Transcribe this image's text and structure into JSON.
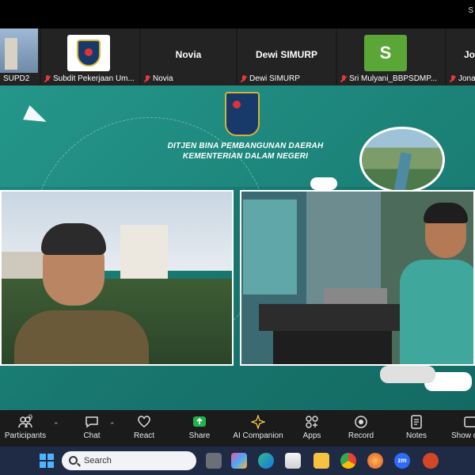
{
  "topbar": {
    "corner_text": "S"
  },
  "participants": [
    {
      "name": "SUPD2",
      "display": ""
    },
    {
      "name": "Subdit Pekerjaan Um...",
      "display": ""
    },
    {
      "name": "Novia",
      "display": "Novia"
    },
    {
      "name": "Dewi SIMURP",
      "display": "Dewi SIMURP"
    },
    {
      "name": "Sri Mulyani_BBPSDMP...",
      "display": "",
      "avatar_letter": "S",
      "avatar_color": "#5aa637"
    },
    {
      "name": "Jonatha",
      "display": "Jo"
    }
  ],
  "slide": {
    "title_line1": "DITJEN BINA PEMBANGUNAN DAERAH",
    "title_line2": "KEMENTERIAN DALAM NEGERI",
    "accent": "#1e8a7f"
  },
  "toolbar": {
    "participants_label": "Participants",
    "participants_count": "9",
    "chat_label": "Chat",
    "react_label": "React",
    "share_label": "Share",
    "ai_label": "AI Companion",
    "apps_label": "Apps",
    "record_label": "Record",
    "notes_label": "Notes",
    "show_label": "Show c",
    "share_color": "#23b14d"
  },
  "taskbar": {
    "search_placeholder": "Search",
    "zoom_label": "zm"
  }
}
